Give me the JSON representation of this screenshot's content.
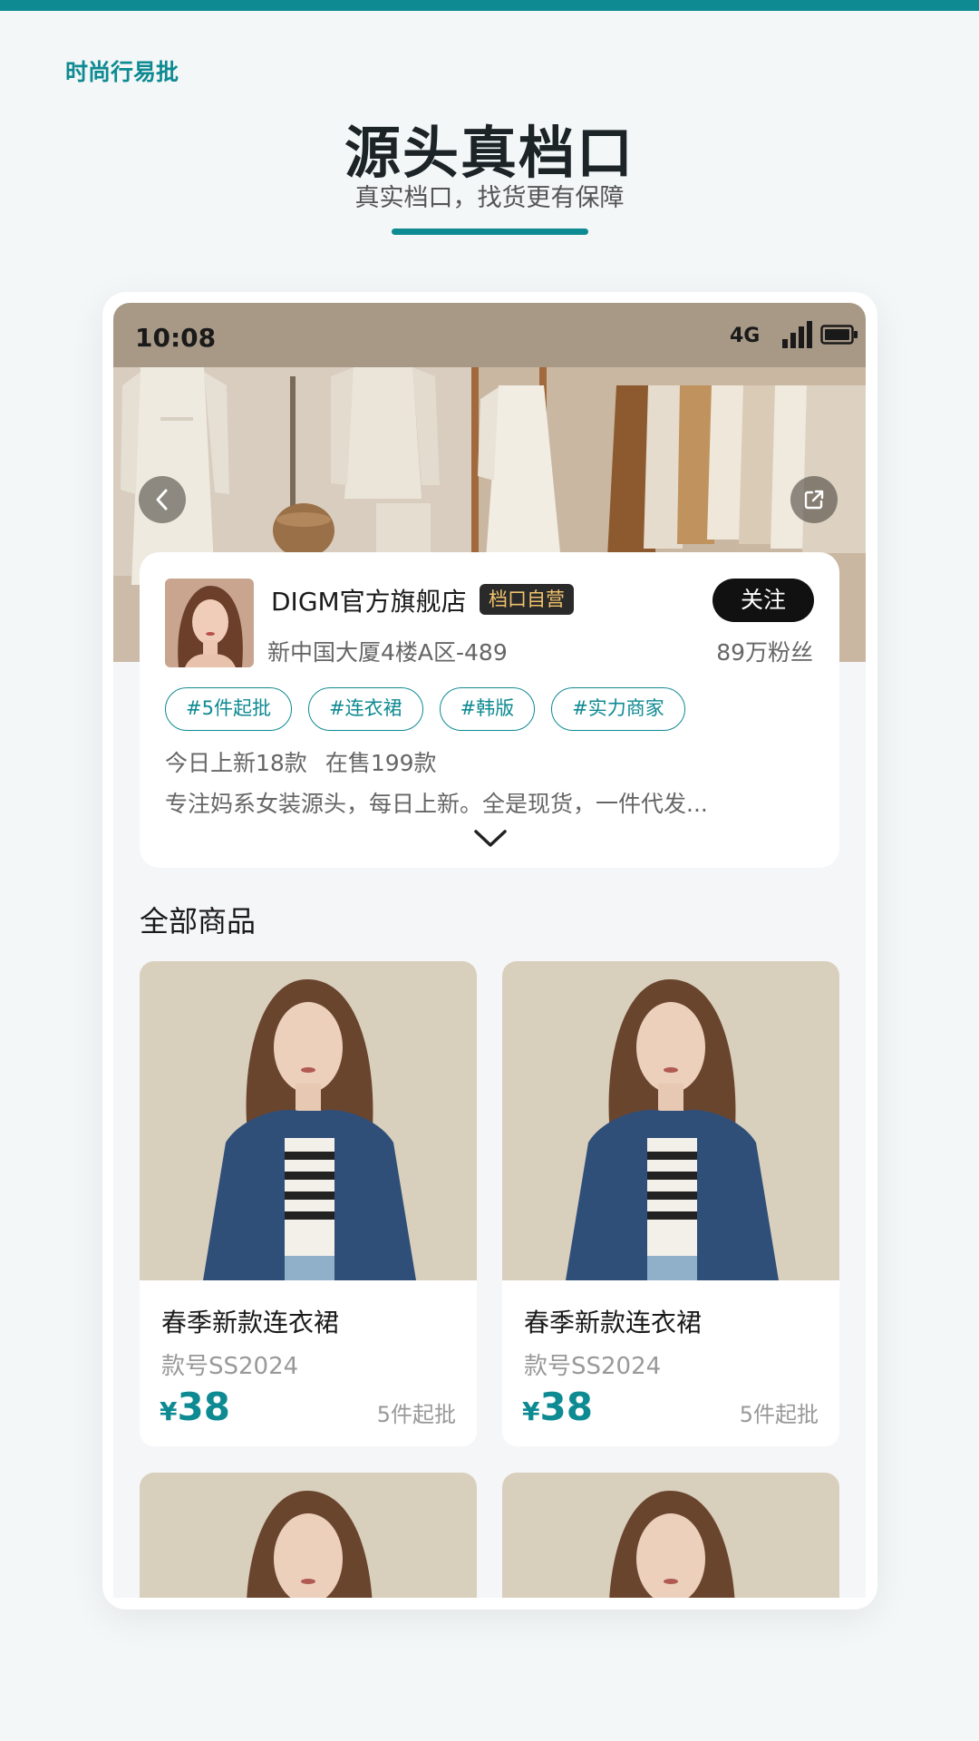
{
  "page": {
    "brand": "时尚行易批",
    "title": "源头真档口",
    "subtitle": "真实档口，找货更有保障"
  },
  "status_bar": {
    "time": "10:08",
    "network": "4G"
  },
  "store": {
    "name": "DIGM官方旗舰店",
    "badge": "档口自营",
    "follow_label": "关注",
    "address": "新中国大厦4楼A区-489",
    "fans": "89万粉丝",
    "tags": [
      "#5件起批",
      "#连衣裙",
      "#韩版",
      "#实力商家"
    ],
    "stats": {
      "new_today": "今日上新18款",
      "on_sale": "在售199款"
    },
    "description": "专注妈系女装源头，每日上新。全是现货，一件代发..."
  },
  "products_section": {
    "title": "全部商品",
    "items": [
      {
        "name": "春季新款连衣裙",
        "code": "款号SS2024",
        "currency": "¥",
        "price": "38",
        "min_order": "5件起批"
      },
      {
        "name": "春季新款连衣裙",
        "code": "款号SS2024",
        "currency": "¥",
        "price": "38",
        "min_order": "5件起批"
      }
    ]
  },
  "icons": [
    "back-icon",
    "share-icon",
    "signal-icon",
    "battery-icon",
    "chevron-down-icon"
  ],
  "colors": {
    "accent": "#0e8a92",
    "badge_text": "#f1c36c",
    "follow_bg": "#111111"
  }
}
